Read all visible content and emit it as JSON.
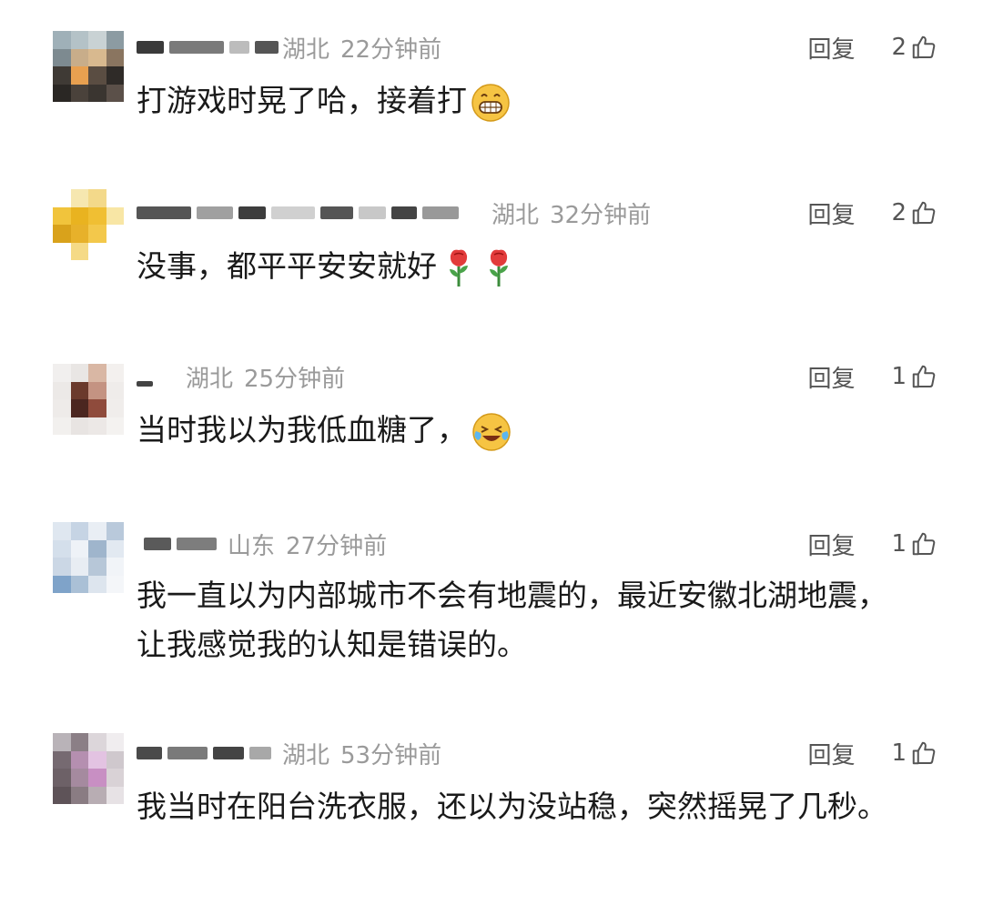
{
  "reply_label": "回复",
  "comments": [
    {
      "location": "湖北",
      "time": "22分钟前",
      "likes": "2",
      "text": "打游戏时晃了哈，接着打",
      "emoji": [
        "grin-emoji"
      ]
    },
    {
      "location": "湖北",
      "time": "32分钟前",
      "likes": "2",
      "text": "没事，都平平安安就好",
      "emoji": [
        "rose-emoji",
        "rose-emoji"
      ]
    },
    {
      "location": "湖北",
      "time": "25分钟前",
      "likes": "1",
      "text": "当时我以为我低血糖了，",
      "emoji": [
        "laugh-cry-emoji"
      ]
    },
    {
      "location": "山东",
      "time": "27分钟前",
      "likes": "1",
      "text": "我一直以为内部城市不会有地震的，最近安徽北湖地震，让我感觉我的认知是错误的。",
      "emoji": []
    },
    {
      "location": "湖北",
      "time": "53分钟前",
      "likes": "1",
      "text": "我当时在阳台洗衣服，还以为没站稳，突然摇晃了几秒。",
      "emoji": []
    }
  ],
  "colors": {
    "meta": "#9a9a9a",
    "text": "#1a1a1a",
    "action": "#555555"
  }
}
